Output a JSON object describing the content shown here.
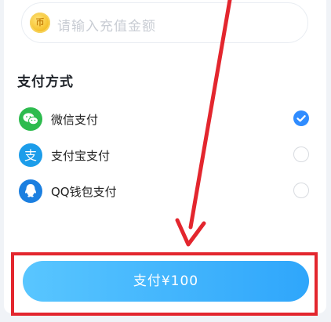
{
  "amount": {
    "coin_icon_text": "币",
    "placeholder": "请输入充值金额"
  },
  "payment": {
    "section_title": "支付方式",
    "methods": [
      {
        "label": "微信支付",
        "icon": "wechat-icon",
        "selected": true
      },
      {
        "label": "支付宝支付",
        "icon": "alipay-icon",
        "selected": false
      },
      {
        "label": "QQ钱包支付",
        "icon": "qq-wallet-icon",
        "selected": false
      }
    ]
  },
  "pay_button": {
    "label": "支付¥100"
  },
  "colors": {
    "accent": "#2f8cff",
    "annotation_red": "#e3262e",
    "wechat": "#2dbb4e",
    "alipay": "#1c9dea",
    "qq": "#1b7fe0"
  }
}
